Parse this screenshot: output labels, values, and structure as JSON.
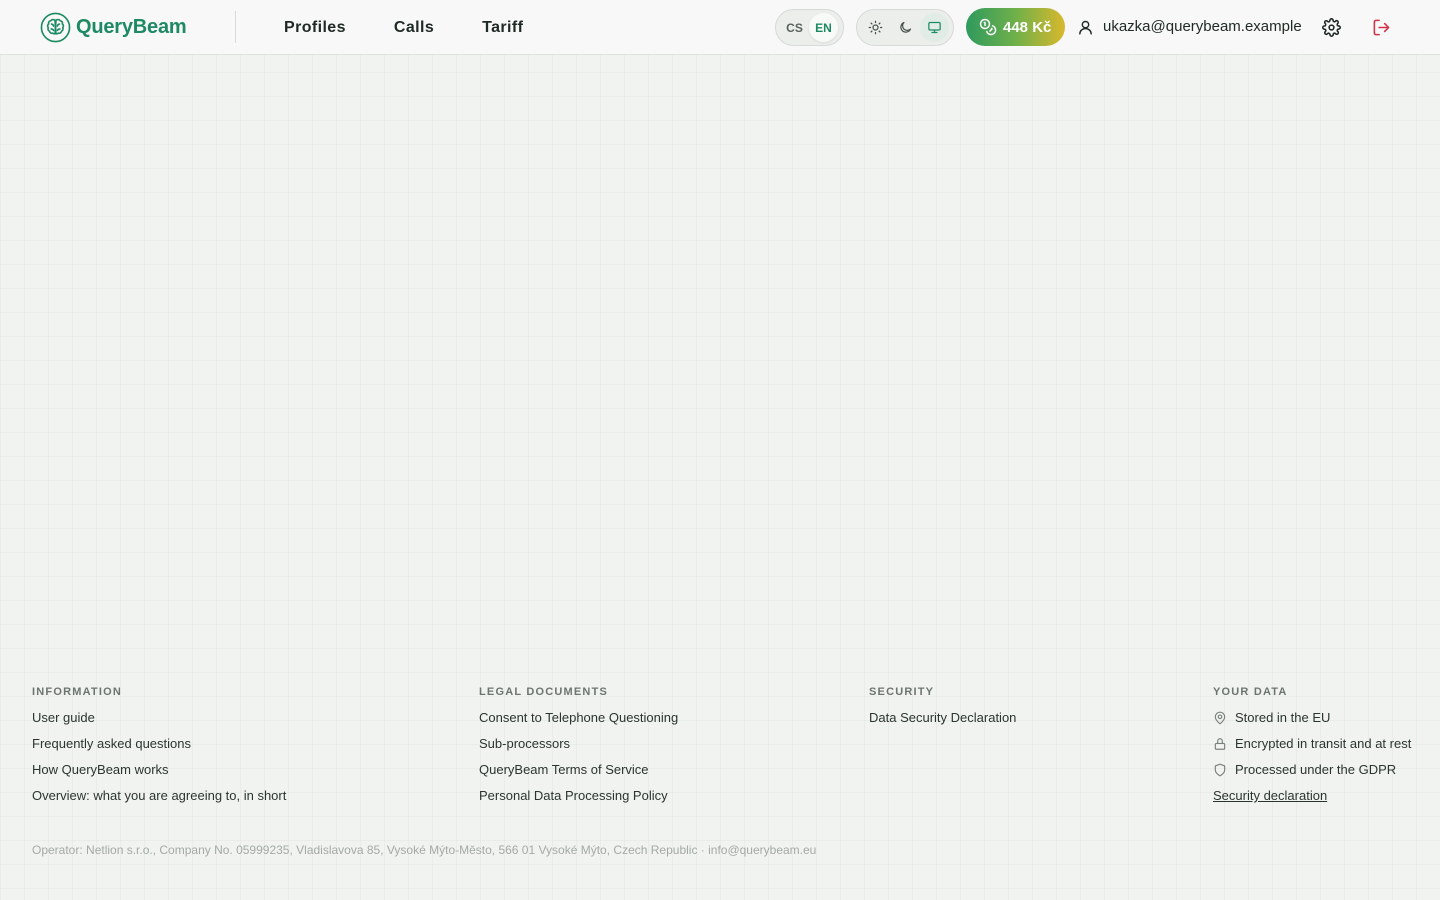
{
  "brand": {
    "name": "QueryBeam",
    "color": "#1e8a63"
  },
  "nav": [
    {
      "label": "Profiles"
    },
    {
      "label": "Calls"
    },
    {
      "label": "Tariff"
    }
  ],
  "language": {
    "options": [
      "CS",
      "EN"
    ],
    "selected": "EN"
  },
  "theme": {
    "options": [
      "sun-icon",
      "moon-icon",
      "monitor-icon"
    ],
    "selected": "monitor-icon"
  },
  "credit": {
    "amount": "448 Kč"
  },
  "user": {
    "email": "ukazka@querybeam.example"
  },
  "footer": {
    "information": {
      "title": "INFORMATION",
      "links": [
        "User guide",
        "Frequently asked questions",
        "How QueryBeam works",
        "Overview: what you are agreeing to, in short"
      ]
    },
    "legal": {
      "title": "LEGAL DOCUMENTS",
      "links": [
        "Consent to Telephone Questioning",
        "Sub-processors",
        "QueryBeam Terms of Service",
        "Personal Data Processing Policy"
      ]
    },
    "security": {
      "title": "SECURITY",
      "links": [
        "Data Security Declaration"
      ]
    },
    "your_data": {
      "title": "YOUR DATA",
      "items": [
        {
          "icon": "map-pin-icon",
          "label": "Stored in the EU"
        },
        {
          "icon": "lock-icon",
          "label": "Encrypted in transit and at rest"
        },
        {
          "icon": "shield-icon",
          "label": "Processed under the GDPR"
        }
      ],
      "link": "Security declaration"
    },
    "operator": "Operator: Netlion s.r.o., Company No. 05999235, Vladislavova 85, Vysoké Mýto-Město, 566 01 Vysoké Mýto, Czech Republic · info@querybeam.eu"
  }
}
